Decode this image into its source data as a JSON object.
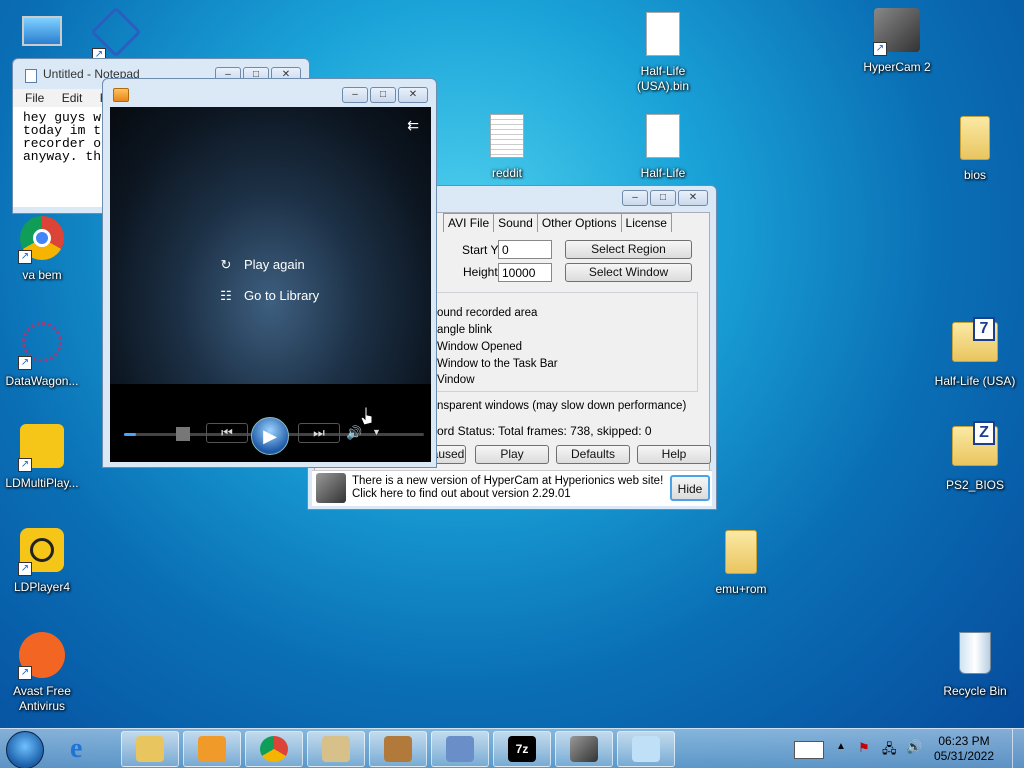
{
  "desktop": {
    "icons": [
      {
        "label": "",
        "name": "computer-icon"
      },
      {
        "label": "",
        "name": "network-icon"
      },
      {
        "label": "va bem",
        "name": "chrome-shortcut-icon"
      },
      {
        "label": "DataWagon...",
        "name": "datawagon-shortcut-icon"
      },
      {
        "label": "LDMultiPlay...",
        "name": "ldmultiplayer-shortcut-icon"
      },
      {
        "label": "LDPlayer4",
        "name": "ldplayer-shortcut-icon"
      },
      {
        "label": "Avast Free Antivirus",
        "name": "avast-shortcut-icon"
      },
      {
        "label": "Half-Life (USA).bin",
        "name": "halflife-bin-file-icon"
      },
      {
        "label": "reddit",
        "name": "reddit-file-icon"
      },
      {
        "label": "Half-Life",
        "name": "halflife-cue-file-icon"
      },
      {
        "label": "HyperCam 2",
        "name": "hypercam-shortcut-icon"
      },
      {
        "label": "bios",
        "name": "bios-folder-icon"
      },
      {
        "label": "Half-Life (USA)",
        "name": "halflife-archive-icon"
      },
      {
        "label": "PS2_BIOS",
        "name": "ps2bios-archive-icon"
      },
      {
        "label": "emu+rom",
        "name": "emurom-folder-icon"
      },
      {
        "label": "Recycle Bin",
        "name": "recycle-bin-icon"
      }
    ]
  },
  "notepad": {
    "title": "Untitled - Notepad",
    "menu": [
      "File",
      "Edit",
      "Fo"
    ],
    "content": "hey guys w\ntoday im t\nrecorder o\nanyway. th"
  },
  "wmp": {
    "play_again": "Play again",
    "go_to_library": "Go to Library",
    "progress": 0.04
  },
  "hypercam": {
    "tabs": [
      "AVI File",
      "Sound",
      "Other Options",
      "License"
    ],
    "start_y_label": "Start Y",
    "start_y_value": "0",
    "height_label": "Height",
    "height_value": "10000",
    "select_region": "Select Region",
    "select_window": "Select Window",
    "options": [
      "ound recorded area",
      "angle blink",
      "Window Opened",
      " Window to the Task Bar",
      "Vindow"
    ],
    "transparent": "nsparent windows (may slow down performance)",
    "status": "ord Status: Total frames: 738, skipped: 0",
    "btn_paused": "aused",
    "btn_play": "Play",
    "btn_defaults": "Defaults",
    "btn_help": "Help",
    "notice": "There is a new version of HyperCam at Hyperionics web site! Click here to find out about version 2.29.01",
    "btn_hide": "Hide"
  },
  "taskbar": {
    "time": "06:23 PM",
    "date": "05/31/2022"
  },
  "colors": {
    "accent": "#1a5fc8",
    "desktop": "#1aa3d8"
  }
}
